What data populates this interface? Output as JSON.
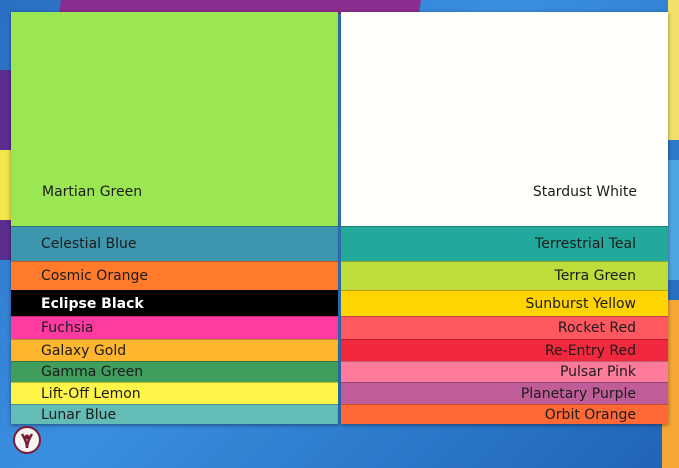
{
  "left_stack": {
    "top_sheet": {
      "label": "Martian Green",
      "color": "#9be753"
    },
    "strips": [
      {
        "label": "Celestial Blue",
        "color": "#3e95ae",
        "text_color": "#1c1c1c",
        "bold": false
      },
      {
        "label": "Cosmic Orange",
        "color": "#ff7a2a",
        "text_color": "#1c1c1c",
        "bold": false
      },
      {
        "label": "Eclipse Black",
        "color": "#000000",
        "text_color": "#ffffff",
        "bold": true
      },
      {
        "label": "Fuchsia",
        "color": "#ff3aa0",
        "text_color": "#1c1c1c",
        "bold": false
      },
      {
        "label": "Galaxy Gold",
        "color": "#ffb52e",
        "text_color": "#1c1c1c",
        "bold": false
      },
      {
        "label": "Gamma Green",
        "color": "#3f9e5c",
        "text_color": "#1c1c1c",
        "bold": false
      },
      {
        "label": "Lift-Off Lemon",
        "color": "#fff548",
        "text_color": "#1c1c1c",
        "bold": false
      },
      {
        "label": "Lunar Blue",
        "color": "#63bcb6",
        "text_color": "#1c1c1c",
        "bold": false
      }
    ]
  },
  "right_stack": {
    "top_sheet": {
      "label": "Stardust White",
      "color": "#fffffb"
    },
    "strips": [
      {
        "label": "Terrestrial Teal",
        "color": "#23a89c",
        "text_color": "#1c1c1c",
        "bold": false
      },
      {
        "label": "Terra Green",
        "color": "#bedc3a",
        "text_color": "#1c1c1c",
        "bold": false
      },
      {
        "label": "Sunburst Yellow",
        "color": "#ffd400",
        "text_color": "#1c1c1c",
        "bold": false
      },
      {
        "label": "Rocket Red",
        "color": "#ff585f",
        "text_color": "#1c1c1c",
        "bold": false
      },
      {
        "label": "Re-Entry Red",
        "color": "#f2283e",
        "text_color": "#1c1c1c",
        "bold": false
      },
      {
        "label": "Pulsar Pink",
        "color": "#ff7b9b",
        "text_color": "#1c1c1c",
        "bold": false
      },
      {
        "label": "Planetary Purple",
        "color": "#c05d98",
        "text_color": "#1c1c1c",
        "bold": false
      },
      {
        "label": "Orbit Orange",
        "color": "#ff6936",
        "text_color": "#1c1c1c",
        "bold": false
      }
    ]
  },
  "logo": {
    "icon": "brand-logo-icon"
  }
}
